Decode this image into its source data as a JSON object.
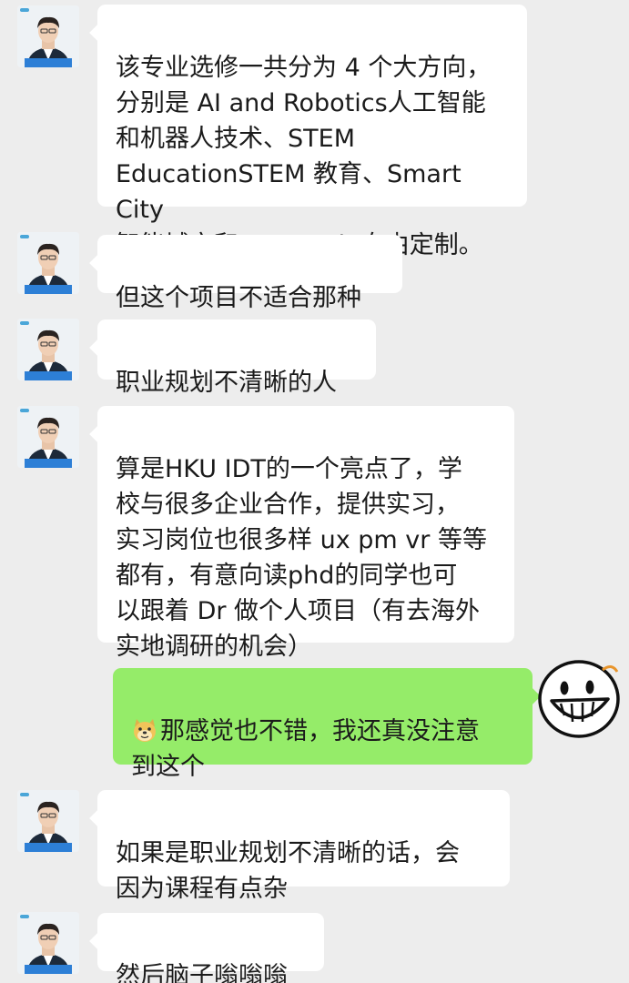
{
  "colors": {
    "background": "#ededed",
    "bubble_incoming": "#ffffff",
    "bubble_outgoing": "#95ec69",
    "text": "#1b1b1b"
  },
  "messages": [
    {
      "sender": "contact",
      "text": "该专业选修一共分为 4 个大方向，\n分别是 AI and Robotics人工智能\n和机器人技术、STEM\nEducationSTEM 教育、Smart City\n智能城市和Free Style自由定制。"
    },
    {
      "sender": "contact",
      "text": "但这个项目不适合那种"
    },
    {
      "sender": "contact",
      "text": "职业规划不清晰的人"
    },
    {
      "sender": "contact",
      "text": "算是HKU IDT的一个亮点了，学\n校与很多企业合作，提供实习，\n实习岗位也很多样 ux pm vr 等等\n都有，有意向读phd的同学也可\n以跟着 Dr 做个人项目（有去海外\n实地调研的机会）"
    },
    {
      "sender": "self",
      "emoji": "doge-emoji",
      "text": "那感觉也不错，我还真没注意\n到这个"
    },
    {
      "sender": "contact",
      "text": "如果是职业规划不清晰的话，会\n因为课程有点杂"
    },
    {
      "sender": "contact",
      "text": "然后脑子嗡嗡嗡"
    }
  ],
  "self_avatar_icon": "grinning-face-doodle-icon",
  "contact_avatar_icon": "person-photo-avatar"
}
